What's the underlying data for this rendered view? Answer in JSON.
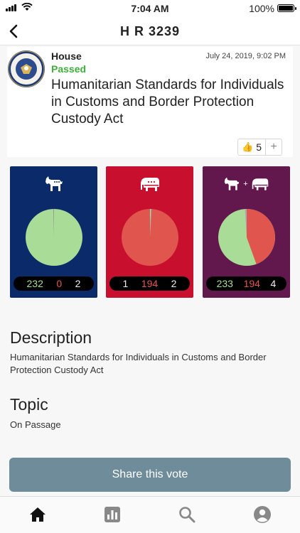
{
  "status_bar": {
    "time": "7:04 AM",
    "battery": "100%"
  },
  "nav": {
    "title": "H R 3239"
  },
  "bill": {
    "chamber": "House",
    "status": "Passed",
    "date": "July 24, 2019, 9:02 PM",
    "title": "Humanitarian Standards for Individuals in Customs and Border Protection Custody Act"
  },
  "reactions": {
    "likes": "5",
    "add": "+"
  },
  "votes": {
    "democrats": {
      "yea": "232",
      "nay": "0",
      "not_voting": "2"
    },
    "republicans": {
      "yea": "1",
      "nay": "194",
      "not_voting": "2"
    },
    "all": {
      "yea": "233",
      "nay": "194",
      "not_voting": "4"
    }
  },
  "colors": {
    "yea": "#a9dd97",
    "nay": "#e0564e",
    "dem": "#0a2a6a",
    "rep": "#c8102e",
    "all": "#62184d",
    "passed": "#3fae3a"
  },
  "description": {
    "heading": "Description",
    "text": "Humanitarian Standards for Individuals in Customs and Border Protection Custody Act"
  },
  "topic": {
    "heading": "Topic",
    "text": "On Passage"
  },
  "share": {
    "label": "Share this vote"
  },
  "tabs": [
    "home-icon",
    "stats-icon",
    "search-icon",
    "profile-icon"
  ]
}
